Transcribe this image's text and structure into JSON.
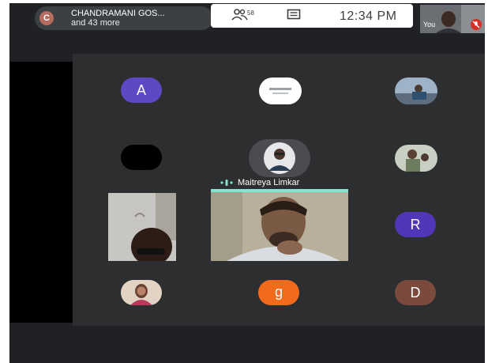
{
  "presenter": {
    "initial": "C",
    "name": "CHANDRAMANI GOS...",
    "more": "and 43 more"
  },
  "controls": {
    "participant_count": "58",
    "time": "12:34 PM"
  },
  "self": {
    "label": "You"
  },
  "tiles": {
    "a": {
      "initial": "A",
      "color": "#5c4ac4"
    },
    "r": {
      "initial": "R",
      "color": "#5236b8"
    },
    "g": {
      "initial": "g",
      "color": "#f26b1d"
    },
    "d": {
      "initial": "D",
      "color": "#7a4a3c"
    },
    "speaker_name": "Maitreya Limkar",
    "active_color": "#7fe6d2"
  }
}
